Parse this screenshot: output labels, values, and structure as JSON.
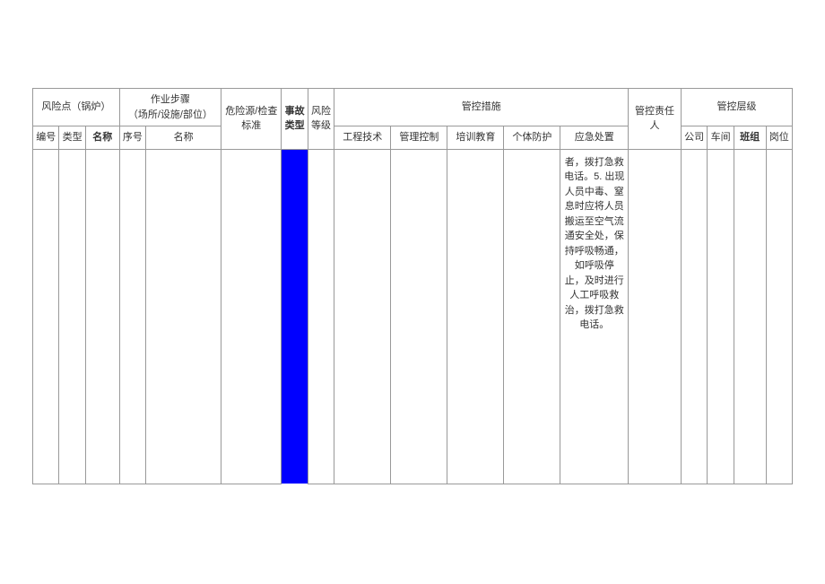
{
  "headers": {
    "riskPoint": "风险点（锅炉）",
    "workStep": "作业步骤\n（场所/设施/部位）",
    "hazard": "危险源/检查标准",
    "accidentType": "事故类型",
    "riskLevel": "风险等级",
    "measures": "管控措施",
    "responsible": "管控责任人",
    "controlLevel": "管控层级",
    "sub": {
      "no": "编号",
      "type": "类型",
      "name": "名称",
      "seq": "序号",
      "stepName": "名称",
      "m1": "工程技术",
      "m2": "管理控制",
      "m3": "培训教育",
      "m4": "个体防护",
      "m5": "应急处置",
      "l1": "公司",
      "l2": "车间",
      "l3": "班组",
      "l4": "岗位"
    }
  },
  "row": {
    "emergency": "者，拨打急救电话。5. 出现人员中毒、窒息时应将人员搬运至空气流通安全处，保持呼吸畅通，如呼吸停\n止，及时进行人工呼吸救\n治，拨打急救电话。"
  }
}
